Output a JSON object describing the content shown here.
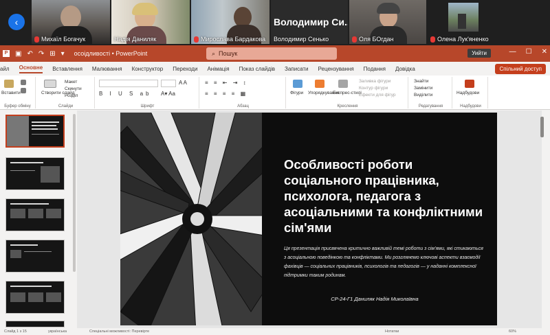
{
  "meeting": {
    "participants": [
      {
        "name": "Михаїл Богачук",
        "muted": true
      },
      {
        "name": "Надія Даниляк",
        "muted": false,
        "active": true
      },
      {
        "name": "Мирослава Бардакова",
        "muted": true
      },
      {
        "name": "Володимир Сенько",
        "muted": false,
        "display_name": "Володимир Си..."
      },
      {
        "name": "Оля БОгдан",
        "muted": true
      },
      {
        "name": "Олена Лук'яненко",
        "muted": true
      }
    ],
    "nav_arrow": "‹"
  },
  "powerpoint": {
    "title_doc": "осоідливості",
    "title_app": "PowerPoint",
    "search_placeholder": "Пошук",
    "exit_button": "Уийти",
    "share_button": "Спільний доступ",
    "menu_tabs": [
      "айл",
      "Основне",
      "Вставлення",
      "Малювання",
      "Конструктор",
      "Переходи",
      "Анімація",
      "Показ слайдів",
      "Записати",
      "Рецензування",
      "Подання",
      "Довідка"
    ],
    "selected_tab": "Основне",
    "ribbon": {
      "paste": "Вставити",
      "new_slide": "Створити слайд",
      "layout": "Макет",
      "reset": "Скинути",
      "section": "Розділ",
      "font_group": "Шрифт",
      "paragraph_group": "Абзац",
      "clipboard_group": "Буфер обміну",
      "slides_group": "Слайди",
      "drawing_group": "Креслення",
      "shapes": "Фігури",
      "arrange": "Упорядкування",
      "quick_styles": "Експрес-стилі",
      "shape_fill": "Заливка фігури",
      "shape_outline": "Контур фігури",
      "shape_effects": "Ефекти для фігур",
      "find": "Знайти",
      "replace": "Замінити",
      "select": "Виділити",
      "editing_group": "Редагування",
      "addins": "Надбудови",
      "addins_group": "Надбудови"
    },
    "slide": {
      "title": "Особливості роботи соціального працівника, психолога, педагога з асоціальними та конфліктними сім'ями",
      "body": "Ця презентація присвячена критично важливій темі роботи з сім'ями, які стикаються з асоціальною поведінкою та конфліктами. Ми розглянемо ключові аспекти взаємодії фахівців — соціальних працівників, психологів та педагогів — у наданні комплексної підтримки таким родинам.",
      "author": "СР-24-Г1 Даниляк Надія Миколаївна"
    },
    "status": {
      "slide_info": "Слайд 1 з 15",
      "language": "українська",
      "accessibility": "Спеціальні можливості: Перевірте",
      "notes": "Нотатки",
      "zoom": "60%"
    }
  },
  "colors": {
    "accent": "#b7472a",
    "share": "#c43e1c",
    "active_speaker": "#3bd16f"
  }
}
